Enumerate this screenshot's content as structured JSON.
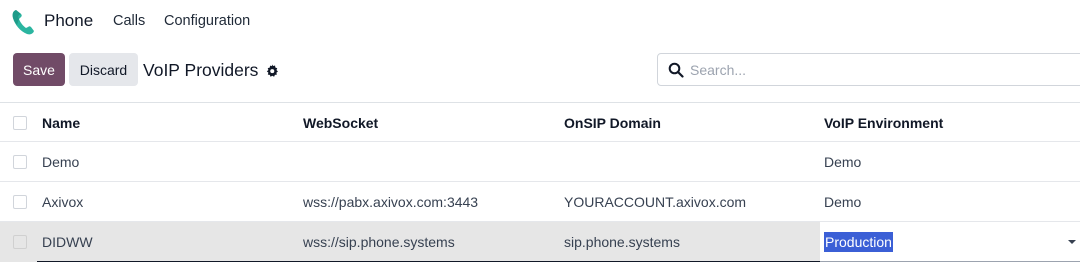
{
  "navbar": {
    "app_name": "Phone",
    "menu": [
      "Calls",
      "Configuration"
    ]
  },
  "control_panel": {
    "save_label": "Save",
    "discard_label": "Discard",
    "breadcrumb": "VoIP Providers",
    "search_placeholder": "Search..."
  },
  "list": {
    "columns": [
      "Name",
      "WebSocket",
      "OnSIP Domain",
      "VoIP Environment"
    ],
    "rows": [
      {
        "name": "Demo",
        "websocket": "",
        "domain": "",
        "environment": "Demo"
      },
      {
        "name": "Axivox",
        "websocket": "wss://pabx.axivox.com:3443",
        "domain": "YOURACCOUNT.axivox.com",
        "environment": "Demo"
      },
      {
        "name": "DIDWW",
        "websocket": "wss://sip.phone.systems",
        "domain": "sip.phone.systems",
        "environment": "Production"
      }
    ]
  },
  "colors": {
    "brand": "#714b67",
    "phone_icon": "#2bb5a0",
    "selection": "#3b5fd6"
  }
}
